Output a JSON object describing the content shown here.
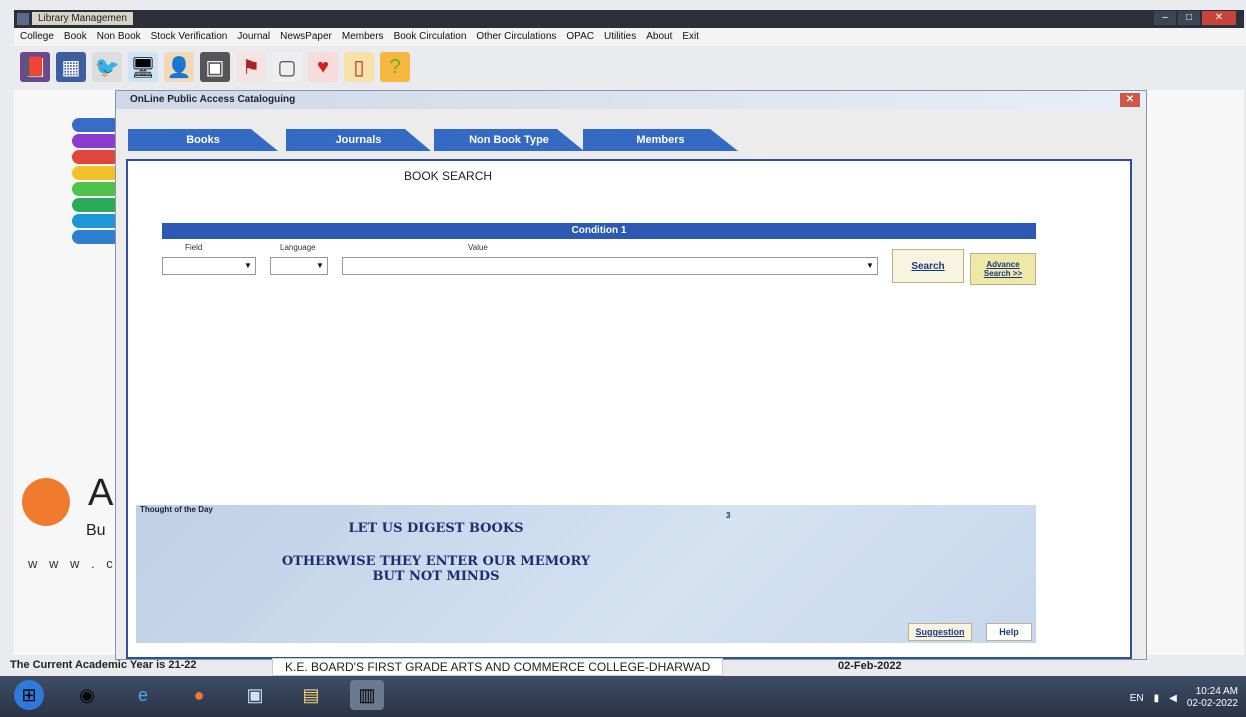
{
  "window": {
    "title": "Library Managemen"
  },
  "menu": [
    "College",
    "Book",
    "Non Book",
    "Stock Verification",
    "Journal",
    "NewsPaper",
    "Members",
    "Book Circulation",
    "Other Circulations",
    "OPAC",
    "Utilities",
    "About",
    "Exit"
  ],
  "toolbar_icons": [
    "book-icon",
    "calendar-icon",
    "bird-icon",
    "monitor-icon",
    "person-icon",
    "register-icon",
    "flag-icon",
    "note-icon",
    "heart-book-icon",
    "door-icon",
    "help-book-icon"
  ],
  "background": {
    "brand_letter": "A",
    "brand_sub": "Bu",
    "brand_www": "w w w . c"
  },
  "opac": {
    "title": "OnLine Public Access Cataloguing",
    "tabs": [
      "Books",
      "Journals",
      "Non Book Type",
      "Members"
    ],
    "heading": "BOOK SEARCH",
    "condition": "Condition 1",
    "field_label": "Field",
    "language_label": "Language",
    "value_label": "Value",
    "search_button": "Search",
    "advance_button_line1": "Advance",
    "advance_button_line2": "Search >>",
    "thought": {
      "label": "Thought of the Day",
      "number": "3",
      "line1": "LET US DIGEST BOOKS",
      "line2": "OTHERWISE THEY ENTER OUR MEMORY",
      "line3": "BUT NOT MINDS"
    },
    "suggestion_button": "Suggestion",
    "help_button": "Help"
  },
  "status": {
    "year": "The Current Academic Year is 21-22",
    "college": "K.E. BOARD'S FIRST GRADE ARTS AND COMMERCE COLLEGE-DHARWAD",
    "date": "02-Feb-2022"
  },
  "taskbar": {
    "clock_time": "10:24 AM",
    "clock_date": "02-02-2022",
    "language": "EN"
  }
}
